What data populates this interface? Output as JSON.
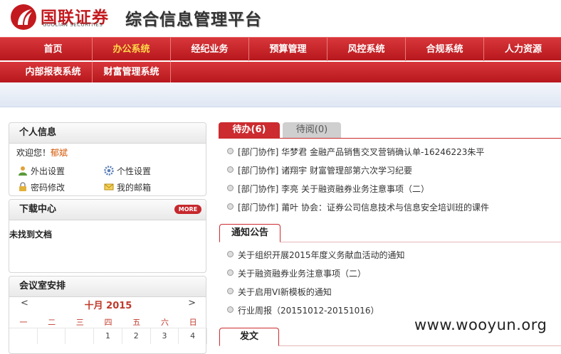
{
  "brand": {
    "name_cn": "国联证券",
    "name_en": "GUOLIAN SECURITIES",
    "app_title": "综合信息管理平台"
  },
  "nav_primary": [
    {
      "label": "首页"
    },
    {
      "label": "办公系统",
      "active": true
    },
    {
      "label": "经纪业务"
    },
    {
      "label": "预算管理"
    },
    {
      "label": "风控系统"
    },
    {
      "label": "合规系统"
    },
    {
      "label": "人力资源"
    }
  ],
  "nav_secondary": [
    {
      "label": "内部报表系统"
    },
    {
      "label": "财富管理系统"
    }
  ],
  "personal": {
    "title": "个人信息",
    "welcome": "欢迎您！",
    "user": "郁斌",
    "links": [
      {
        "label": "外出设置",
        "icon": "person-icon"
      },
      {
        "label": "个性设置",
        "icon": "gear-icon"
      },
      {
        "label": "密码修改",
        "icon": "lock-icon"
      },
      {
        "label": "我的邮箱",
        "icon": "mail-icon"
      }
    ]
  },
  "download": {
    "title": "下载中心",
    "more": "MORE",
    "empty": "未找到文档"
  },
  "meeting": {
    "title": "会议室安排",
    "prev": "<",
    "next": ">",
    "month": "十月 2015",
    "weekdays": [
      "一",
      "二",
      "三",
      "四",
      "五",
      "六",
      "日"
    ],
    "first_week": [
      "",
      "",
      "",
      "1",
      "2",
      "3",
      "4"
    ]
  },
  "tabs": [
    {
      "label": "待办(6)",
      "active": true
    },
    {
      "label": "待阅(0)",
      "active": false
    }
  ],
  "todo_items": [
    "[部门协作] 华梦君 金融产品销售交叉营销确认单-16246223朱平",
    "[部门协作] 诸翔宇 财富管理部第六次学习纪要",
    "[部门协作] 李亮 关于融资融券业务注意事项（二）",
    "[部门协作] 莆叶 协会：证券公司信息技术与信息安全培训班的课件"
  ],
  "notice": {
    "title": "通知公告",
    "items": [
      "关于组织开展2015年度义务献血活动的通知",
      "关于融资融券业务注意事项（二）",
      "关于启用VI新模板的通知",
      "行业周报（20151012-20151016）"
    ]
  },
  "dispatch": {
    "title": "发文"
  },
  "watermark": "www.wooyun.org",
  "colors": {
    "brand_red": "#cc2b2f",
    "nav_active": "#ffd94a",
    "user_name": "#d35400"
  }
}
